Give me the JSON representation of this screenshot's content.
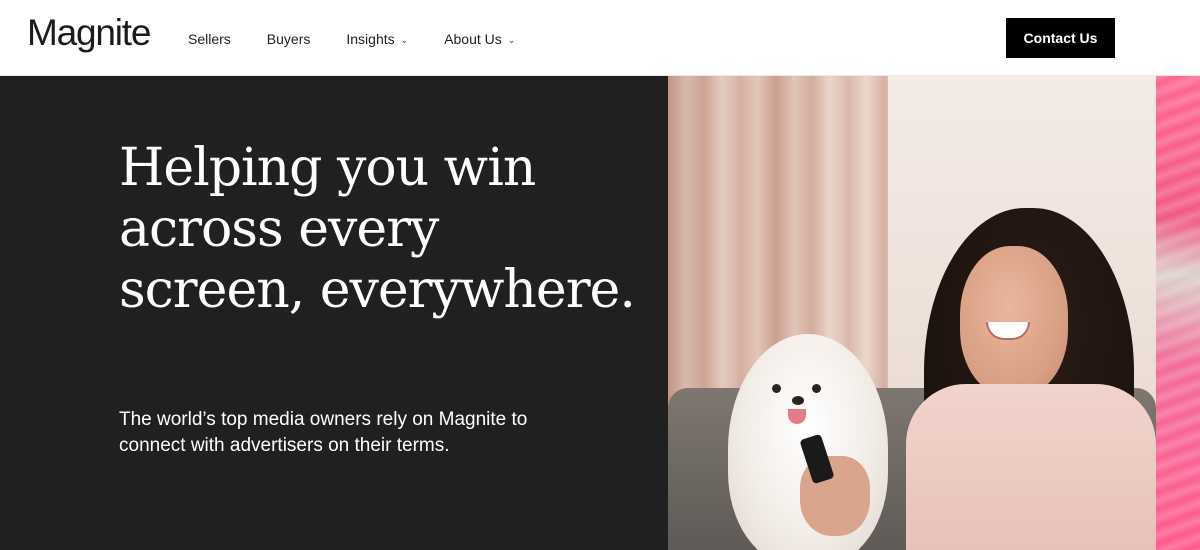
{
  "header": {
    "logo_text": "Magnite",
    "nav": [
      {
        "label": "Sellers",
        "has_dropdown": false
      },
      {
        "label": "Buyers",
        "has_dropdown": false
      },
      {
        "label": "Insights",
        "has_dropdown": true
      },
      {
        "label": "About Us",
        "has_dropdown": true
      }
    ],
    "cta_label": "Contact Us"
  },
  "hero": {
    "headline": "Helping you win across every screen, everywhere.",
    "subtext": "The world’s top media owners rely on Magnite to connect with advertisers on their terms."
  },
  "colors": {
    "header_bg": "#ffffff",
    "hero_bg": "#202020",
    "cta_bg": "#000000",
    "accent_strip": "#ff5c8a"
  },
  "icons": {
    "dropdown": "chevron-down-icon"
  }
}
